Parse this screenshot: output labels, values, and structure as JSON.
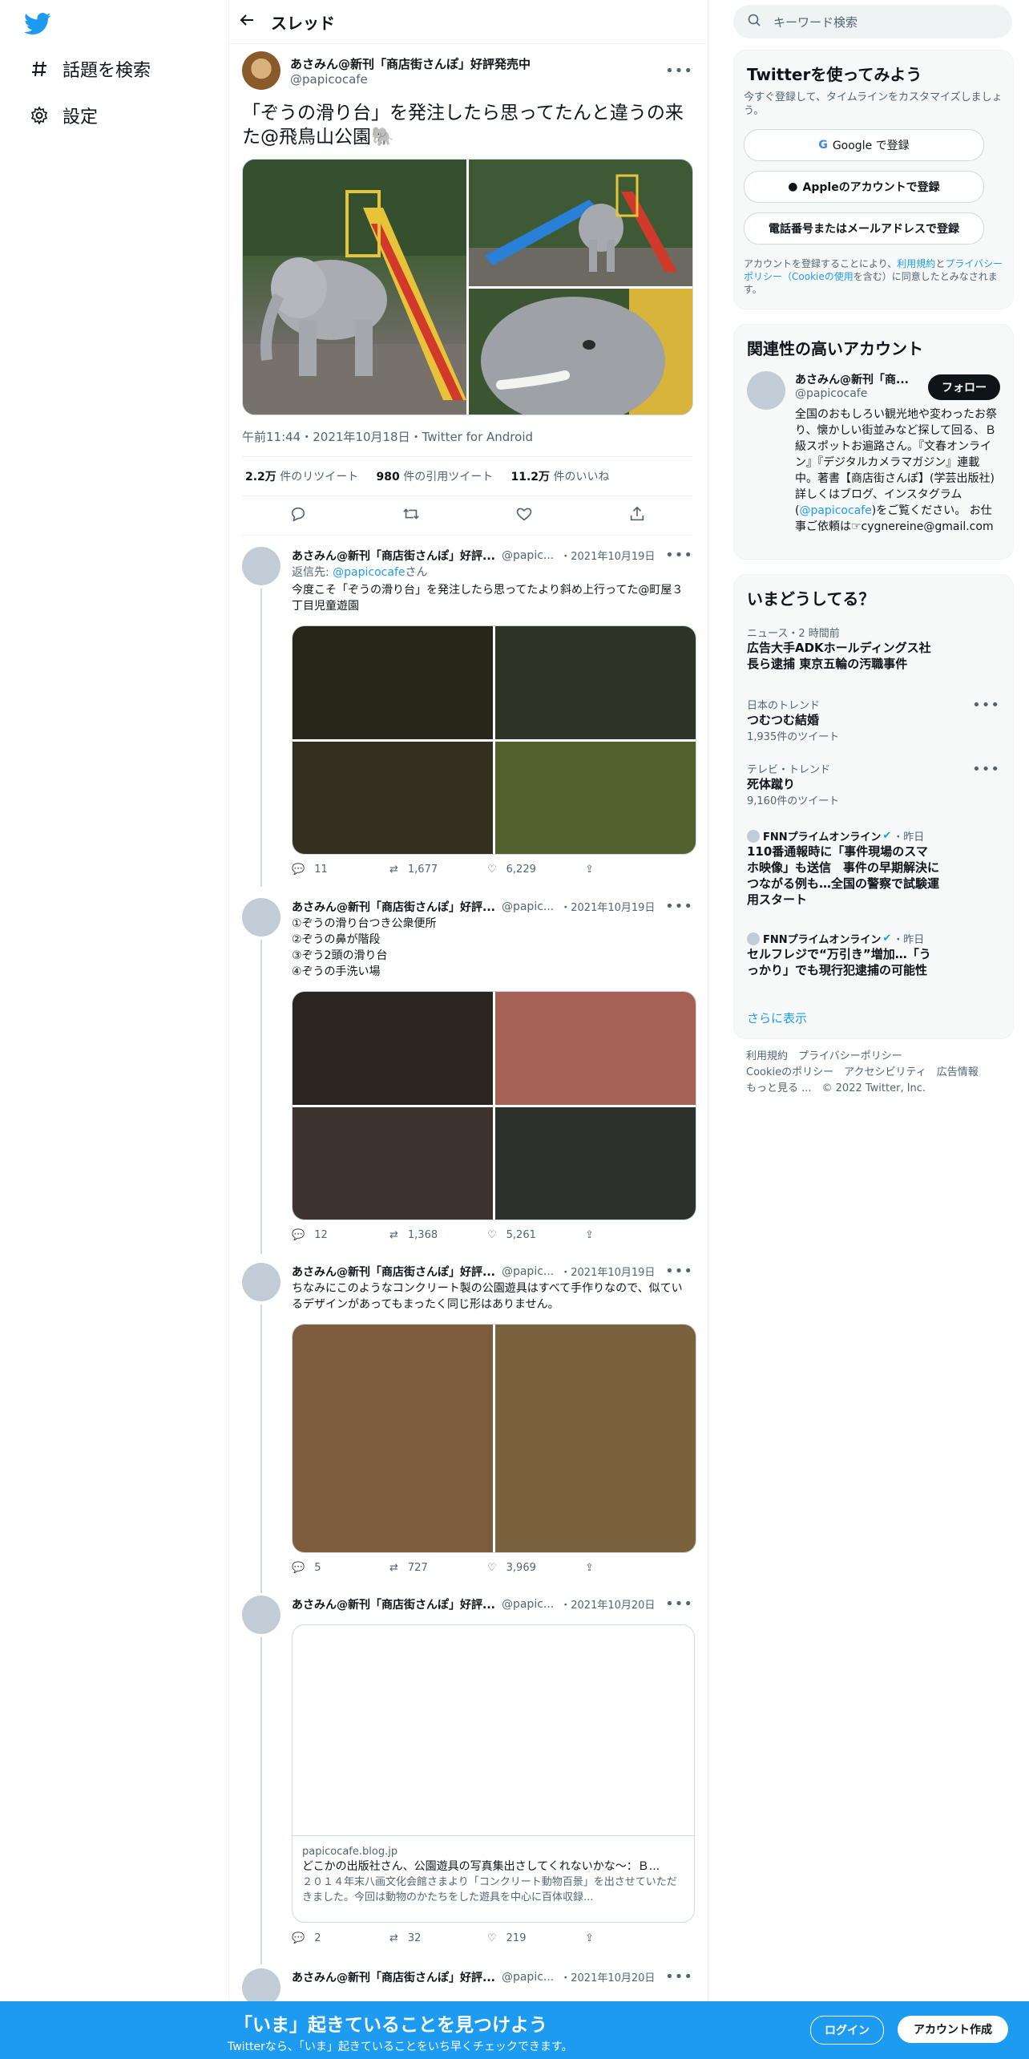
{
  "nav": {
    "explore_label": "話題を検索",
    "settings_label": "設定"
  },
  "header": {
    "title": "スレッド"
  },
  "main_tweet": {
    "author_name": "あさみん@新刊「商店街さんぽ」好評発売中",
    "author_handle": "@papicocafe",
    "text": "「ぞうの滑り台」を発注したら思ってたんと違うの来た@飛鳥山公園🐘",
    "timestamp": "午前11:44・2021年10月18日・Twitter for Android",
    "retweets": "2.2万",
    "retweets_label": "件のリツイート",
    "quotes": "980",
    "quotes_label": "件の引用ツイート",
    "likes": "11.2万",
    "likes_label": "件のいいね"
  },
  "replies": [
    {
      "author_name": "あさみん@新刊「商店街さんぽ」好評...",
      "author_handle": "@papic...",
      "date": "・2021年10月19日",
      "reply_to_prefix": "返信先: ",
      "reply_to_handle": "@papicocafe",
      "reply_to_suffix": "さん",
      "text": "今度こそ「ぞうの滑り台」を発注したら思ってたより斜め上行ってた@町屋３丁目児童遊園",
      "reply_count": "11",
      "retweet_count": "1,677",
      "like_count": "6,229"
    },
    {
      "author_name": "あさみん@新刊「商店街さんぽ」好評...",
      "author_handle": "@papic...",
      "date": "・2021年10月19日",
      "lines": [
        "①ぞうの滑り台つき公衆便所",
        "②ぞうの鼻が階段",
        "③ぞう2頭の滑り台",
        "④ぞうの手洗い場"
      ],
      "reply_count": "12",
      "retweet_count": "1,368",
      "like_count": "5,261"
    },
    {
      "author_name": "あさみん@新刊「商店街さんぽ」好評...",
      "author_handle": "@papic...",
      "date": "・2021年10月19日",
      "text": "ちなみにこのようなコンクリート製の公園遊具はすべて手作りなので、似ているデザインがあってもまったく同じ形はありません。",
      "reply_count": "5",
      "retweet_count": "727",
      "like_count": "3,969"
    },
    {
      "author_name": "あさみん@新刊「商店街さんぽ」好評...",
      "author_handle": "@papic...",
      "date": "・2021年10月20日",
      "card_domain": "papicocafe.blog.jp",
      "card_title": "どこかの出版社さん、公園遊具の写真集出さしてくれないかな～：Ｂ...",
      "card_desc": "２０１４年末八画文化会館さまより「コンクリート動物百景」を出させていただきました。今回は動物のかたちをした遊具を中心に百体収録...",
      "reply_count": "2",
      "retweet_count": "32",
      "like_count": "219"
    },
    {
      "author_name": "あさみん@新刊「商店街さんぽ」好評...",
      "author_handle": "@papic...",
      "date": "・2021年10月20日"
    }
  ],
  "right": {
    "search_placeholder": "キーワード検索",
    "signup": {
      "title": "Twitterを使ってみよう",
      "desc": "今すぐ登録して、タイムラインをカスタマイズしましょう。",
      "google": "Google で登録",
      "apple": "Appleのアカウントで登録",
      "phone": "電話番号またはメールアドレスで登録",
      "terms_1": "アカウントを登録することにより、",
      "terms_link1": "利用規約",
      "terms_2": "と",
      "terms_link2": "プライバシーポリシー（Cookieの使用",
      "terms_3": "を含む）に同意したとみなされます。"
    },
    "related": {
      "title": "関連性の高いアカウント",
      "name": "あさみん@新刊「商...",
      "handle": "@papicocafe",
      "follow": "フォロー",
      "bio_1": "全国のおもしろい観光地や変わったお祭り、懐かしい街並みなど探して回る、Ｂ級スポットお遍路さん。『文春オンライン』『デジタルカメラマガジン』連載中。著書【商店街さんぽ】(学芸出版社)　　詳しくはブログ、インスタグラム(",
      "bio_link": "@papicocafe",
      "bio_2": ")をご覧ください。 お仕事ご依頼は☞cygnereine@gmail.com"
    },
    "trends": {
      "title": "いまどうしてる？",
      "items": [
        {
          "cat": "ニュース・2 時間前",
          "title": "広告大手ADKホールディングス社長ら逮捕 東京五輪の汚職事件",
          "count": ""
        },
        {
          "cat": "日本のトレンド",
          "title": "つむつむ結婚",
          "count": "1,935件のツイート"
        },
        {
          "cat": "テレビ・トレンド",
          "title": "死体蹴り",
          "count": "9,160件のツイート"
        },
        {
          "cat": "FNNプライムオンライン",
          "cat_suffix": "・昨日",
          "title": "110番通報時に「事件現場のスマホ映像」も送信　事件の早期解決につながる例も…全国の警察で試験運用スタート",
          "count": ""
        },
        {
          "cat": "FNNプライムオンライン",
          "cat_suffix": "・昨日",
          "title": "セルフレジで“万引き”増加…「うっかり」でも現行犯逮捕の可能性",
          "count": ""
        }
      ],
      "more": "さらに表示"
    },
    "footer": {
      "line1": "利用規約　プライバシーポリシー",
      "line2": "Cookieのポリシー　アクセシビリティ　広告情報",
      "line3": "もっと見る ...　© 2022 Twitter, Inc."
    }
  },
  "banner": {
    "title": "「いま」起きていることを見つけよう",
    "subtitle": "Twitterなら、「いま」起きていることをいち早くチェックできます。",
    "login": "ログイン",
    "signup": "アカウント作成"
  },
  "colors": {
    "accent": "#1d9bf0",
    "text": "#0f1419",
    "muted": "#536471"
  }
}
